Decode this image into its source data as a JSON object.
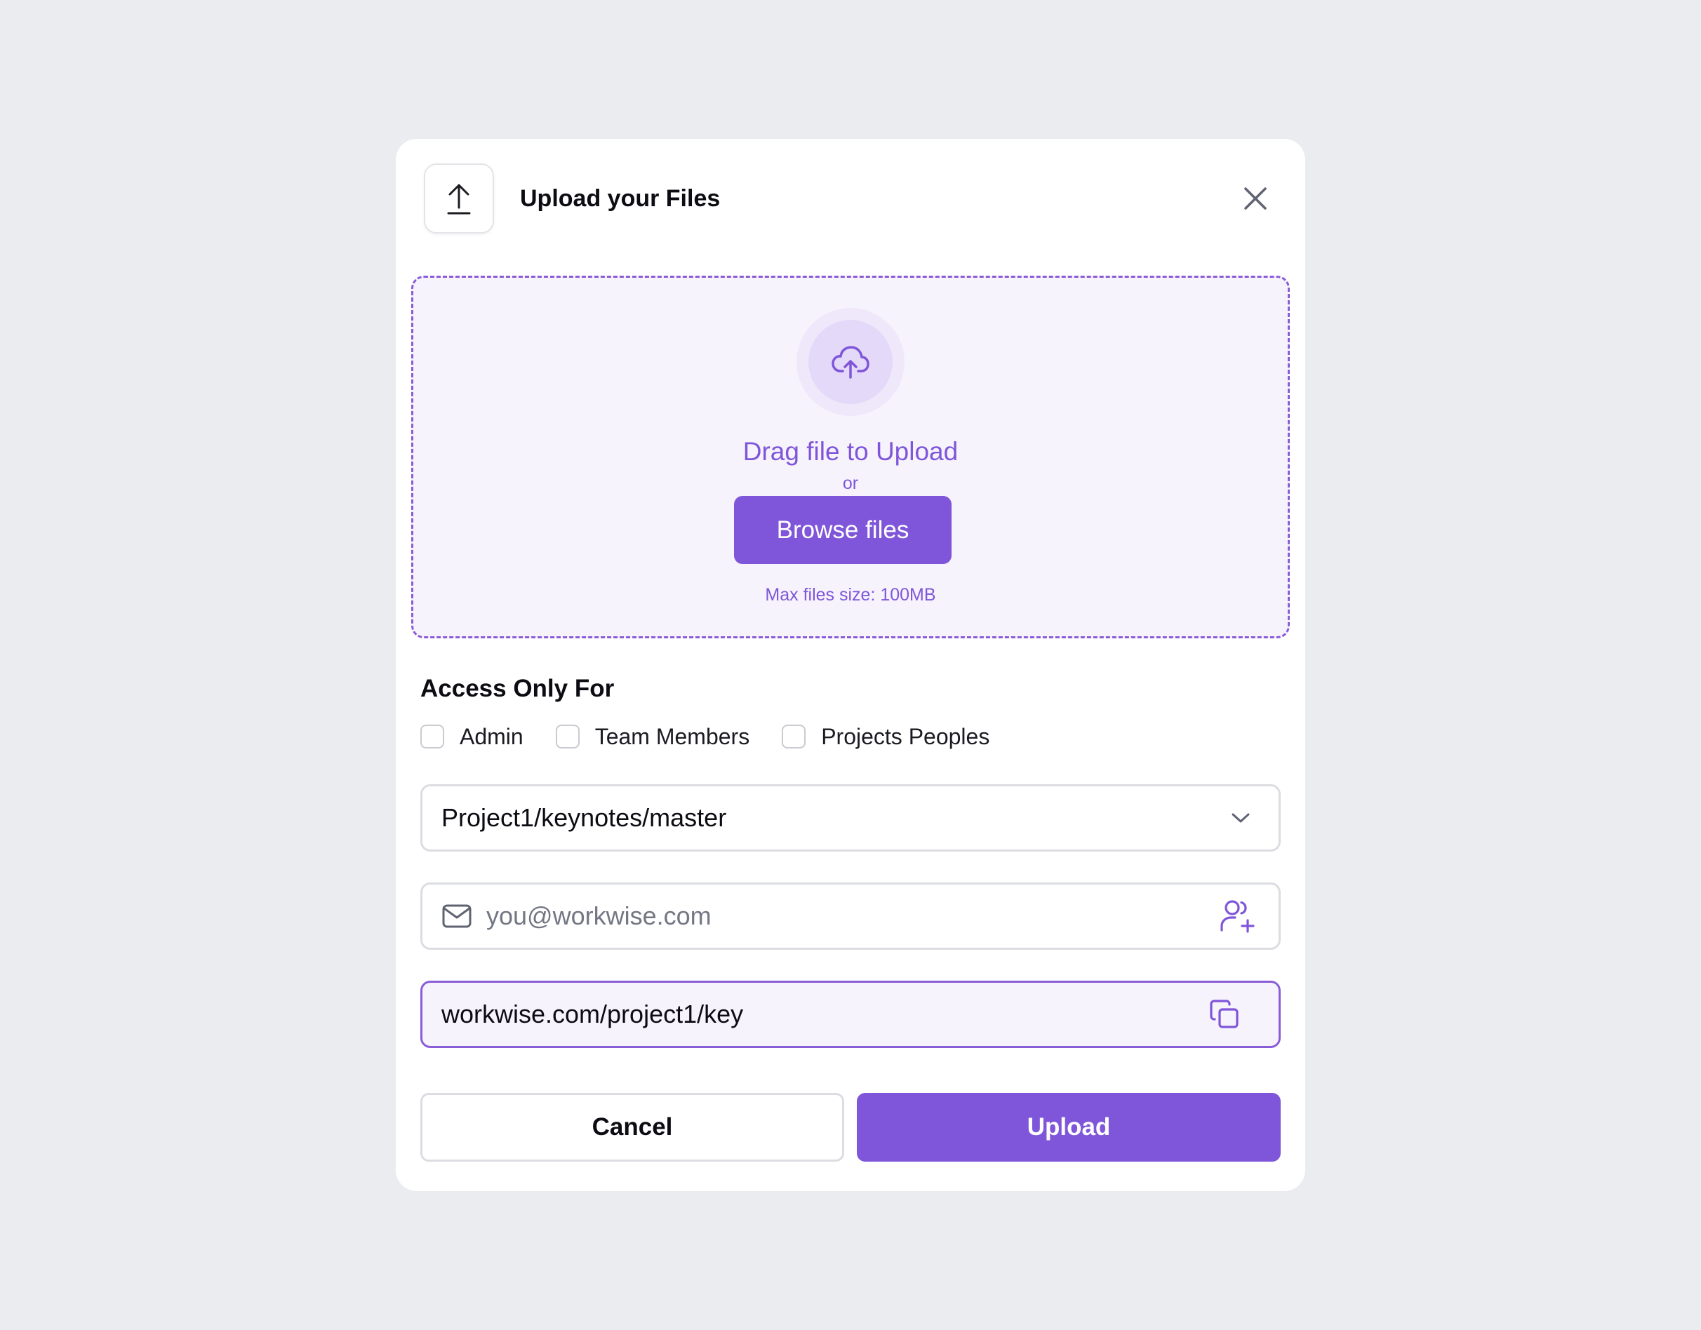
{
  "modal": {
    "title": "Upload your Files",
    "header_icon": "upload-arrow-icon",
    "close_icon": "close-icon"
  },
  "dropzone": {
    "icon": "cloud-upload-icon",
    "drag_text": "Drag file to Upload",
    "or_text": "or",
    "browse_label": "Browse files",
    "max_size_text": "Max files size: 100MB"
  },
  "access": {
    "title": "Access Only For",
    "options": [
      {
        "label": "Admin",
        "checked": false
      },
      {
        "label": "Team Members",
        "checked": false
      },
      {
        "label": "Projects Peoples",
        "checked": false
      }
    ]
  },
  "path_select": {
    "value": "Project1/keynotes/master",
    "icon": "chevron-down-icon"
  },
  "email": {
    "value": "",
    "placeholder": "you@workwise.com",
    "leading_icon": "mail-icon",
    "trailing_icon": "add-user-icon"
  },
  "share_link": {
    "value": "workwise.com/project1/key",
    "icon": "copy-icon"
  },
  "actions": {
    "cancel_label": "Cancel",
    "upload_label": "Upload"
  },
  "colors": {
    "accent": "#7f56d9",
    "dropzone_bg": "#f6f3fd",
    "page_bg": "#ebecef"
  }
}
